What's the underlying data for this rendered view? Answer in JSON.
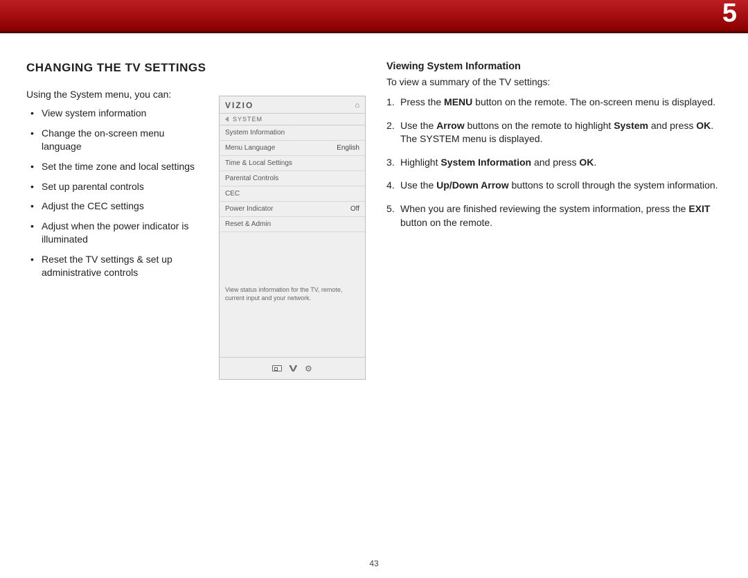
{
  "banner": {
    "chapter_number": "5"
  },
  "page_number": "43",
  "left": {
    "heading": "CHANGING THE TV SETTINGS",
    "intro": "Using the System menu, you can:",
    "bullets": [
      "View system information",
      "Change the on-screen menu language",
      "Set the time zone and local settings",
      "Set up parental controls",
      "Adjust the CEC settings",
      "Adjust when the power indicator is illuminated",
      "Reset the TV settings & set up administrative controls"
    ]
  },
  "tv_menu": {
    "logo": "VIZIO",
    "breadcrumb": "SYSTEM",
    "rows": [
      {
        "label": "System Information",
        "value": ""
      },
      {
        "label": "Menu Language",
        "value": "English"
      },
      {
        "label": "Time & Local Settings",
        "value": ""
      },
      {
        "label": "Parental Controls",
        "value": ""
      },
      {
        "label": "CEC",
        "value": ""
      },
      {
        "label": "Power Indicator",
        "value": "Off"
      },
      {
        "label": "Reset & Admin",
        "value": ""
      }
    ],
    "help_text": "View status information for the TV, remote, current input and your network."
  },
  "right": {
    "subheading": "Viewing System Information",
    "lead": "To view a summary of the TV settings:",
    "steps_html": [
      "Press the <b>MENU</b> button on the remote. The on-screen menu is displayed.",
      "Use the <b>Arrow</b> buttons on the remote to highlight <b>System</b> and press <b>OK</b>. The SYSTEM menu is displayed.",
      "Highlight <b>System Information</b> and press <b>OK</b>.",
      "Use the <b>Up/Down Arrow</b> buttons to scroll through the system information.",
      "When you are finished reviewing the system information, press the <b>EXIT</b> button on the remote."
    ]
  }
}
